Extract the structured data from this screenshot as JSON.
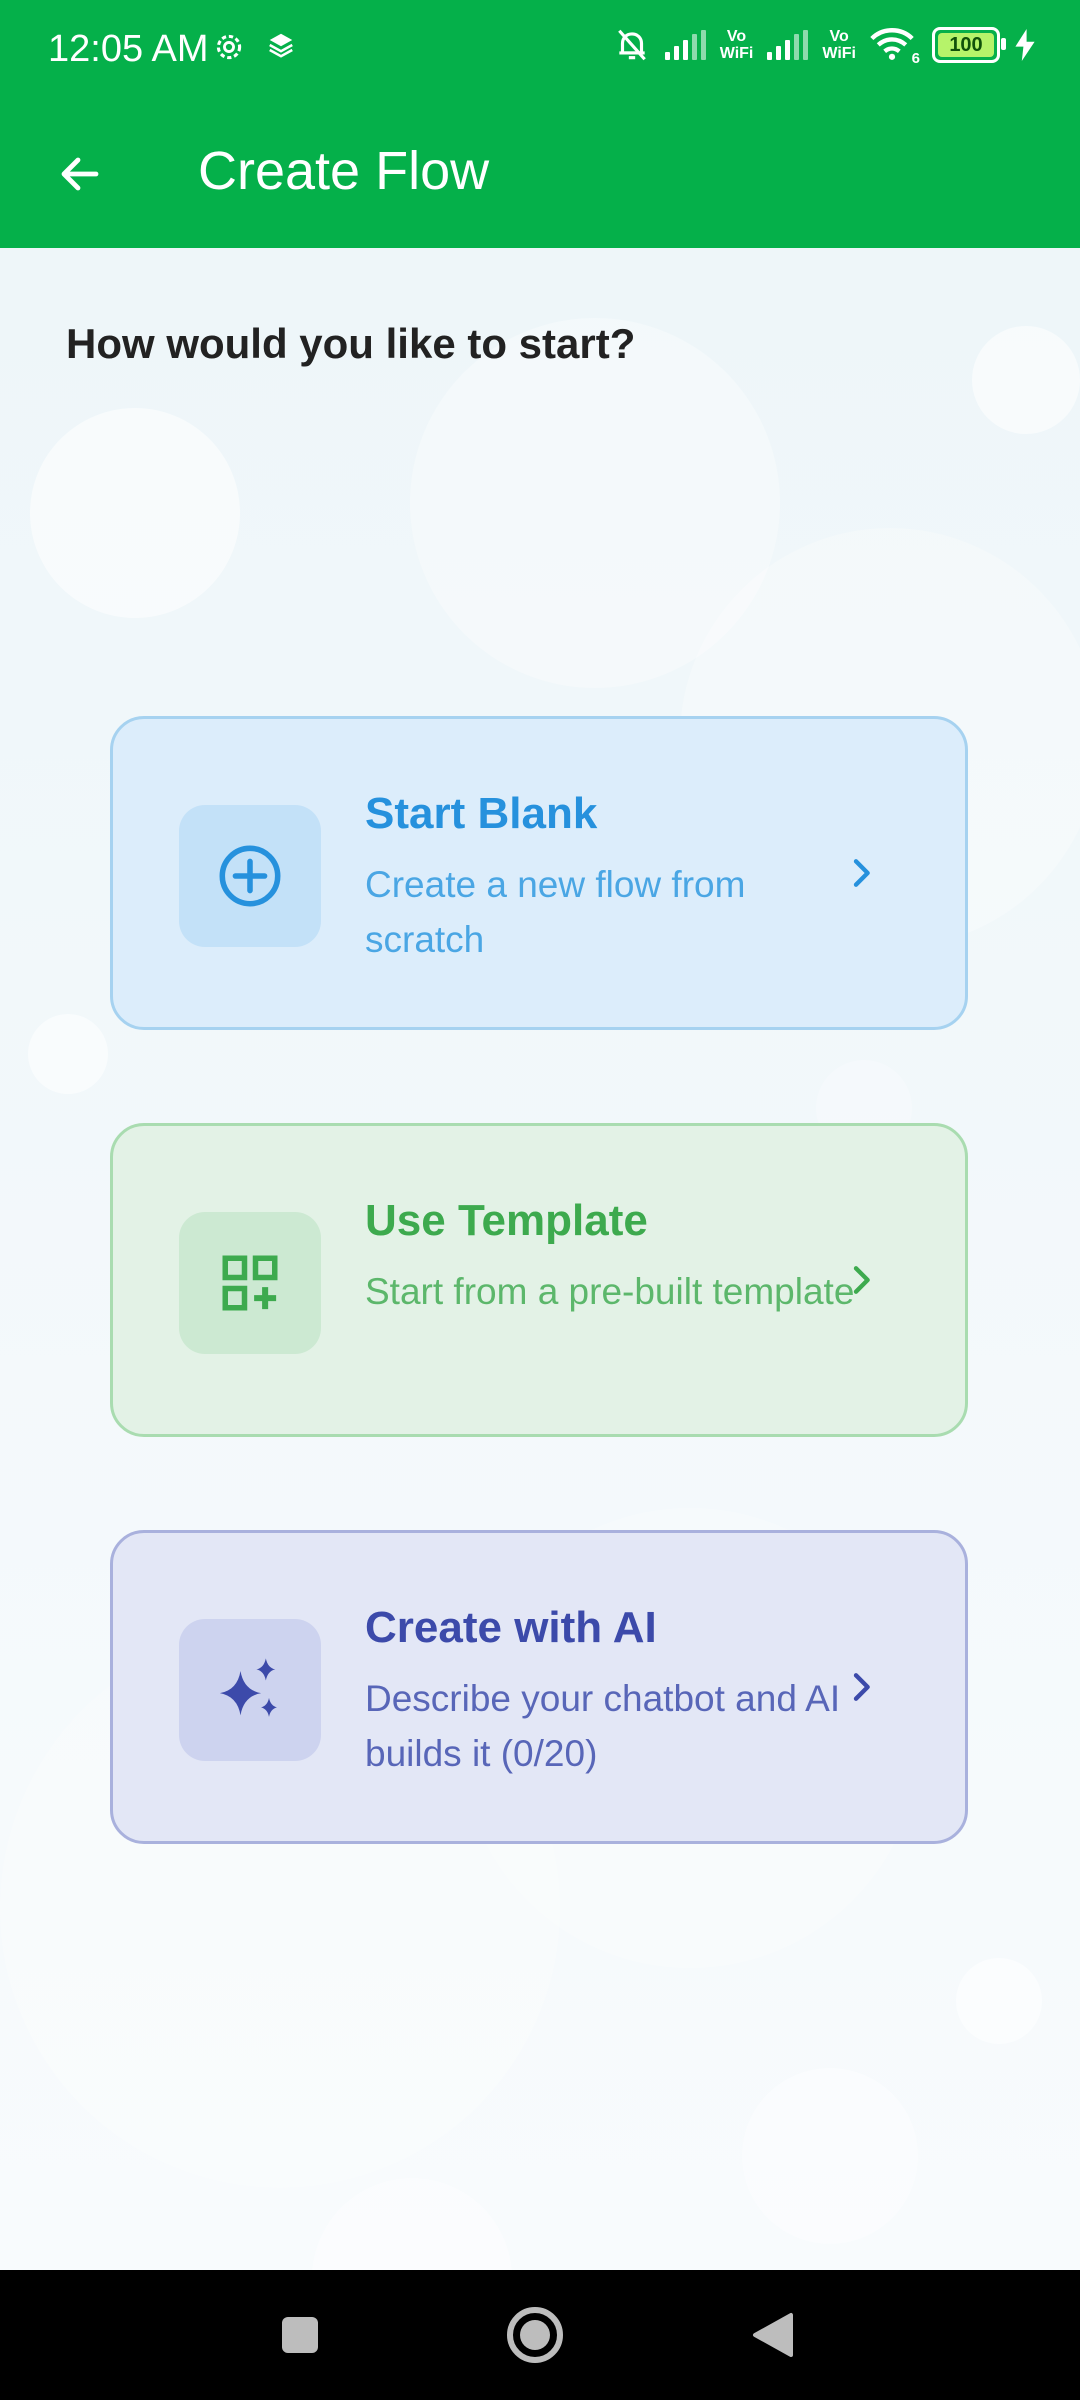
{
  "status_bar": {
    "time": "12:05 AM",
    "vowifi_1": "Vo\nWiFi",
    "vowifi_2": "Vo\nWiFi",
    "wifi_badge": "6",
    "battery": "100"
  },
  "app_bar": {
    "title": "Create Flow"
  },
  "main": {
    "prompt": "How would you like to start?",
    "options": [
      {
        "title": "Start Blank",
        "description": "Create a new flow from scratch",
        "icon": "add-circle-icon"
      },
      {
        "title": "Use Template",
        "description": "Start from a pre-built template",
        "icon": "grid-add-icon"
      },
      {
        "title": "Create with AI",
        "description": "Describe your chatbot and AI builds it (0/20)",
        "icon": "sparkles-icon"
      }
    ]
  },
  "colors": {
    "app_bar": "#05b04a",
    "blank_accent": "#2691dd",
    "template_accent": "#3daa4e",
    "ai_accent": "#3c4aaa"
  }
}
